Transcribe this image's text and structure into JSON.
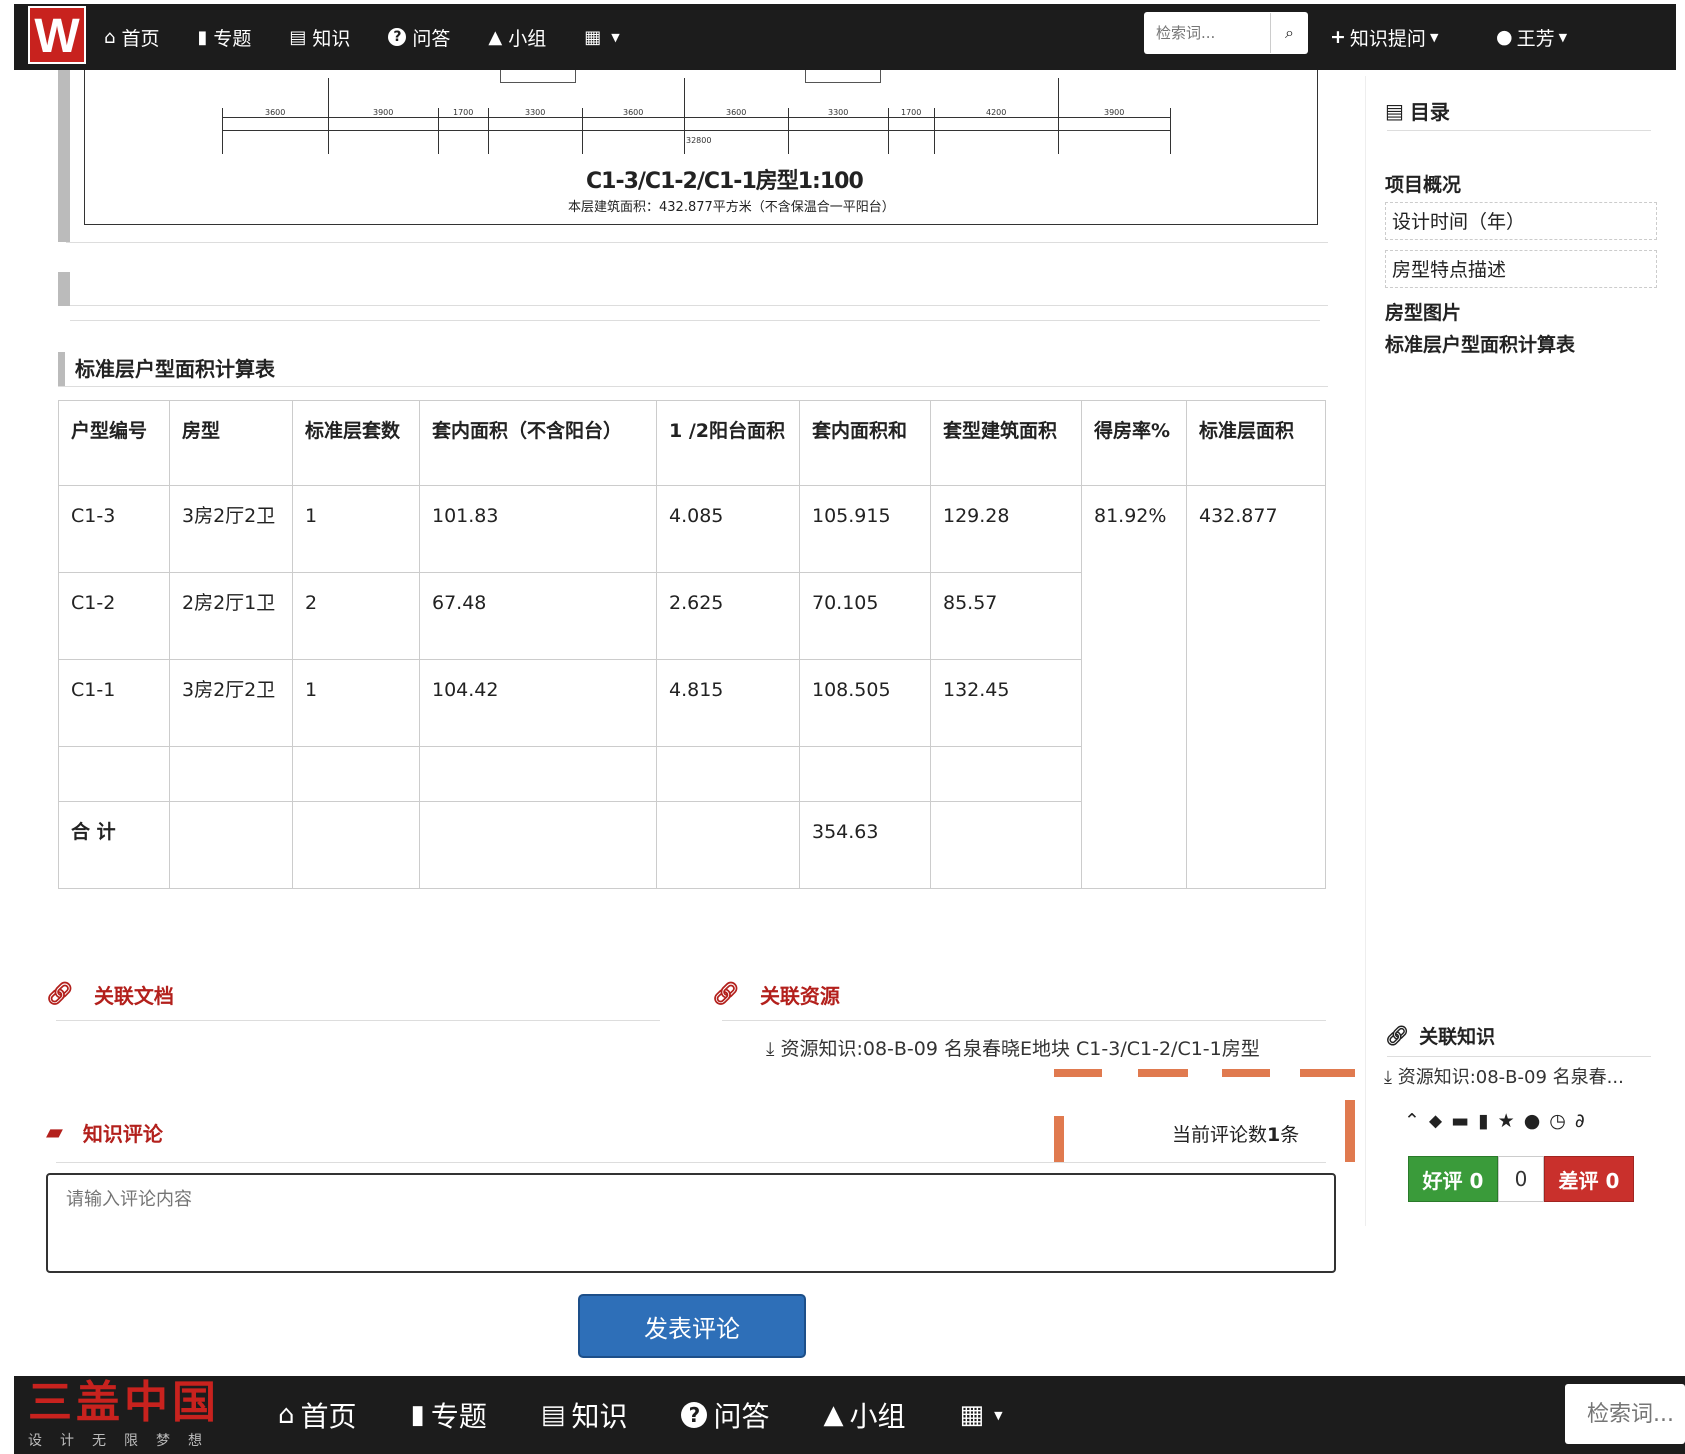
{
  "nav": {
    "logo": "W",
    "items": [
      {
        "icon": "home-icon",
        "glyph": "⌂",
        "label": "首页"
      },
      {
        "icon": "bookmark-icon",
        "glyph": "▮",
        "label": "专题"
      },
      {
        "icon": "book-icon",
        "glyph": "▤",
        "label": "知识"
      },
      {
        "icon": "question-icon",
        "glyph": "?",
        "label": "问答"
      },
      {
        "icon": "tree-icon",
        "glyph": "▲",
        "label": "小组"
      }
    ],
    "search_placeholder": "检索词...",
    "ask": "知识提问",
    "user": "王芳"
  },
  "drawing": {
    "dims": [
      "3600",
      "3900",
      "1700",
      "3300",
      "3600",
      "3600",
      "3300",
      "1700",
      "4200",
      "3900"
    ],
    "total": "32800",
    "title": "C1-3/C1-2/C1-1房型1:100",
    "subtitle": "本层建筑面积：432.877平方米（不含保温合一平阳台）"
  },
  "table_section_title": "标准层户型面积计算表",
  "table": {
    "headers": [
      "户型编号",
      "房型",
      "标准层套数",
      "套内面积（不含阳台）",
      "1 /2阳台面积",
      "套内面积和",
      "套型建筑面积",
      "得房率%",
      "标准层面积"
    ],
    "rows": [
      [
        "C1-3",
        "3房2厅2卫",
        "1",
        "101.83",
        "4.085",
        "105.915",
        "129.28"
      ],
      [
        "C1-2",
        "2房2厅1卫",
        "2",
        "67.48",
        "2.625",
        "70.105",
        "85.57"
      ],
      [
        "C1-1",
        "3房2厅2卫",
        "1",
        "104.42",
        "4.815",
        "108.505",
        "132.45"
      ],
      [
        "",
        "",
        "",
        "",
        "",
        "",
        ""
      ]
    ],
    "merged_rate": "81.92%",
    "merged_area": "432.877",
    "total_row": [
      "合 计",
      "",
      "",
      "",
      "",
      "354.63",
      ""
    ]
  },
  "related_docs": {
    "title": "关联文档"
  },
  "related_resources": {
    "title": "关联资源",
    "item": "资源知识:08-B-09 名泉春晓E地块 C1-3/C1-2/C1-1房型"
  },
  "comments": {
    "title": "知识评论",
    "count_prefix": "当前评论数",
    "count": "1",
    "count_suffix": "条",
    "placeholder": "请输入评论内容",
    "post_label": "发表评论"
  },
  "sidebar": {
    "toc_title": "目录",
    "toc": [
      {
        "label": "项目概况",
        "type": "item"
      },
      {
        "label": "设计时间（年）",
        "type": "sub"
      },
      {
        "label": "房型特点描述",
        "type": "sub"
      },
      {
        "label": "房型图片",
        "type": "item"
      },
      {
        "label": "标准层户型面积计算表",
        "type": "item"
      }
    ],
    "related_title": "关联知识",
    "related_item": "资源知识:08-B-09 名泉春...",
    "good_label": "好评 0",
    "neutral": "0",
    "bad_label": "差评 0"
  },
  "footer": {
    "brand": "三盖中国",
    "slogan": "设计无限梦想",
    "items": [
      {
        "icon": "home-icon",
        "glyph": "⌂",
        "label": "首页"
      },
      {
        "icon": "bookmark-icon",
        "glyph": "▮",
        "label": "专题"
      },
      {
        "icon": "book-icon",
        "glyph": "▤",
        "label": "知识"
      },
      {
        "icon": "question-icon",
        "glyph": "?",
        "label": "问答"
      },
      {
        "icon": "tree-icon",
        "glyph": "▲",
        "label": "小组"
      }
    ],
    "search_placeholder": "检索词..."
  },
  "colors": {
    "nav_bg": "#1c1c1c",
    "brand_red": "#c8221e",
    "link_red": "#b3201c",
    "primary_blue": "#2e6fb8",
    "good_green": "#3a9b3a",
    "bad_red": "#c9302c",
    "dash_orange": "#e07a4f"
  }
}
